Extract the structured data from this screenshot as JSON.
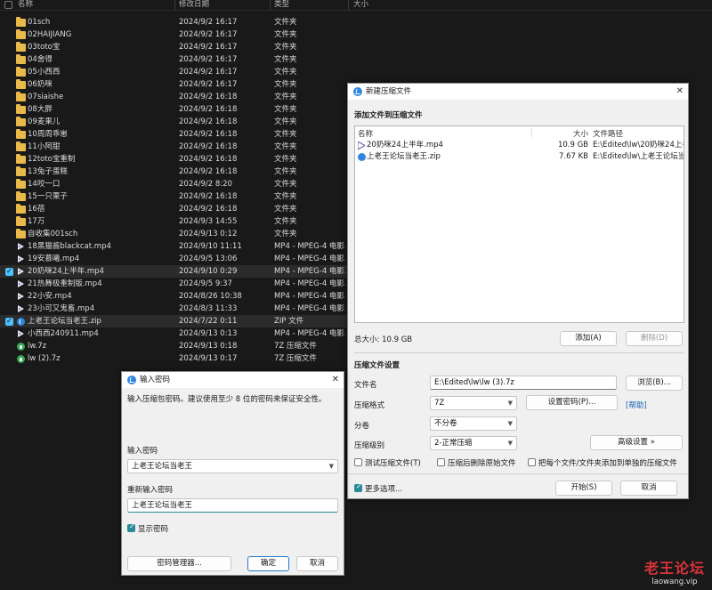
{
  "explorer": {
    "headers": {
      "name": "名称",
      "date": "修改日期",
      "type": "类型",
      "size": "大小"
    },
    "rows": [
      {
        "name": "01sch",
        "date": "2024/9/2 16:17",
        "type": "文件夹",
        "kind": "folder"
      },
      {
        "name": "02HAIJIANG",
        "date": "2024/9/2 16:17",
        "type": "文件夹",
        "kind": "folder"
      },
      {
        "name": "03toto宝",
        "date": "2024/9/2 16:17",
        "type": "文件夹",
        "kind": "folder"
      },
      {
        "name": "04舍得",
        "date": "2024/9/2 16:17",
        "type": "文件夹",
        "kind": "folder"
      },
      {
        "name": "05小西西",
        "date": "2024/9/2 16:17",
        "type": "文件夹",
        "kind": "folder"
      },
      {
        "name": "06奶咪",
        "date": "2024/9/2 16:17",
        "type": "文件夹",
        "kind": "folder"
      },
      {
        "name": "07siaishe",
        "date": "2024/9/2 16:18",
        "type": "文件夹",
        "kind": "folder"
      },
      {
        "name": "08大胖",
        "date": "2024/9/2 16:18",
        "type": "文件夹",
        "kind": "folder"
      },
      {
        "name": "09麦果儿",
        "date": "2024/9/2 16:18",
        "type": "文件夹",
        "kind": "folder"
      },
      {
        "name": "10周周乖崽",
        "date": "2024/9/2 16:18",
        "type": "文件夹",
        "kind": "folder"
      },
      {
        "name": "11小阿甜",
        "date": "2024/9/2 16:18",
        "type": "文件夹",
        "kind": "folder"
      },
      {
        "name": "12toto宝重制",
        "date": "2024/9/2 16:18",
        "type": "文件夹",
        "kind": "folder"
      },
      {
        "name": "13兔子蛋糕",
        "date": "2024/9/2 16:18",
        "type": "文件夹",
        "kind": "folder"
      },
      {
        "name": "14咬一口",
        "date": "2024/9/2 8:20",
        "type": "文件夹",
        "kind": "folder"
      },
      {
        "name": "15一只栗子",
        "date": "2024/9/2 16:18",
        "type": "文件夹",
        "kind": "folder"
      },
      {
        "name": "16蓓",
        "date": "2024/9/2 16:18",
        "type": "文件夹",
        "kind": "folder"
      },
      {
        "name": "17万",
        "date": "2024/9/3 14:55",
        "type": "文件夹",
        "kind": "folder"
      },
      {
        "name": "自收集001sch",
        "date": "2024/9/13 0:12",
        "type": "文件夹",
        "kind": "folder"
      },
      {
        "name": "18黑猫酱blackcat.mp4",
        "date": "2024/9/10 11:11",
        "type": "MP4 - MPEG-4 电影...",
        "kind": "video"
      },
      {
        "name": "19安慕曦.mp4",
        "date": "2024/9/5 13:06",
        "type": "MP4 - MPEG-4 电影...",
        "kind": "video"
      },
      {
        "name": "20奶咪24上半年.mp4",
        "date": "2024/9/10 0:29",
        "type": "MP4 - MPEG-4 电影...",
        "kind": "video",
        "selected": true
      },
      {
        "name": "21热舞极重制版.mp4",
        "date": "2024/9/5 9:37",
        "type": "MP4 - MPEG-4 电影...",
        "kind": "video"
      },
      {
        "name": "22小安.mp4",
        "date": "2024/8/26 10:38",
        "type": "MP4 - MPEG-4 电影...",
        "kind": "video"
      },
      {
        "name": "23小可又鬼畜.mp4",
        "date": "2024/8/3 11:33",
        "type": "MP4 - MPEG-4 电影...",
        "kind": "video"
      },
      {
        "name": "上老王论坛当老王.zip",
        "date": "2024/7/22 0:11",
        "type": "ZIP 文件",
        "kind": "zip",
        "selected": true
      },
      {
        "name": "小西西240911.mp4",
        "date": "2024/9/13 0:13",
        "type": "MP4 - MPEG-4 电影...",
        "kind": "video"
      },
      {
        "name": "lw.7z",
        "date": "2024/9/13 0:18",
        "type": "7Z 压缩文件",
        "kind": "7z"
      },
      {
        "name": "lw (2).7z",
        "date": "2024/9/13 0:17",
        "type": "7Z 压缩文件",
        "kind": "7z"
      }
    ]
  },
  "archive_dialog": {
    "title": "新建压缩文件",
    "close": "✕",
    "section_add": "添加文件到压缩文件",
    "list_headers": {
      "name": "名称",
      "size": "大小",
      "path": "文件路径"
    },
    "files": [
      {
        "name": "20奶咪24上半年.mp4",
        "size": "10.9 GB",
        "path": "E:\\Edited\\lw\\20奶咪24上半年"
      },
      {
        "name": "上老王论坛当老王.zip",
        "size": "7.67 KB",
        "path": "E:\\Edited\\lw\\上老王论坛当老"
      }
    ],
    "total_size": "总大小: 10.9 GB",
    "add_button": "添加(A)",
    "remove_button": "删除(D)",
    "section_settings": "压缩文件设置",
    "filename_label": "文件名",
    "filename_value": "E:\\Edited\\lw\\lw (3).7z",
    "browse_button": "浏览(B)...",
    "format_label": "压缩格式",
    "format_value": "7Z",
    "set_password_button": "设置密码(P)...",
    "help_link": "[帮助]",
    "volume_label": "分卷",
    "volume_value": "不分卷",
    "level_label": "压缩级别",
    "level_value": "2-正常压缩",
    "advanced_button": "高级设置 »",
    "test_checkbox": "测试压缩文件(T)",
    "delete_checkbox": "压缩后删除原始文件",
    "separate_checkbox": "把每个文件/文件夹添加到单独的压缩文件",
    "more_options": "更多选项...",
    "start_button": "开始(S)",
    "cancel_button": "取消"
  },
  "password_dialog": {
    "title": "输入密码",
    "close": "✕",
    "hint": "输入压缩包密码。建议使用至少 8 位的密码来保证安全性。",
    "password_label": "输入密码",
    "password_value": "上老王论坛当老王",
    "confirm_label": "重新输入密码",
    "confirm_value": "上老王论坛当老王",
    "show_password": "显示密码",
    "manager_button": "密码管理器...",
    "ok_button": "确定",
    "cancel_button": "取消"
  },
  "watermark": {
    "title": "老王论坛",
    "url": "laowang.vip"
  }
}
